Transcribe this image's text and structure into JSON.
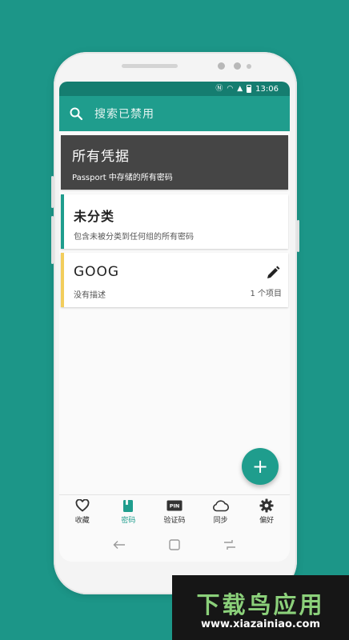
{
  "status_bar": {
    "time": "13:06"
  },
  "search": {
    "placeholder": "搜索已禁用"
  },
  "groups": [
    {
      "title": "所有凭据",
      "description": "Passport 中存储的所有密码"
    },
    {
      "title": "未分类",
      "description": "包含未被分类到任何组的所有密码",
      "accent": "#1f9d8d"
    },
    {
      "title": "GOOG",
      "description": "没有描述",
      "count": "1 个项目",
      "accent": "#f2cd5c"
    }
  ],
  "fab": {
    "label": "+"
  },
  "bottom_nav": [
    {
      "label": "收藏",
      "icon": "heart-icon"
    },
    {
      "label": "密码",
      "icon": "book-icon",
      "active": true
    },
    {
      "label": "验证码",
      "icon": "pin-icon"
    },
    {
      "label": "同步",
      "icon": "cloud-icon"
    },
    {
      "label": "偏好",
      "icon": "gear-icon"
    }
  ],
  "watermark": {
    "logo": "下载鸟应用",
    "url": "www.xiazainiao.com"
  },
  "colors": {
    "background": "#1c9688",
    "primary": "#1f9d8d",
    "status_bar": "#157d70",
    "dark_card": "#454545"
  }
}
